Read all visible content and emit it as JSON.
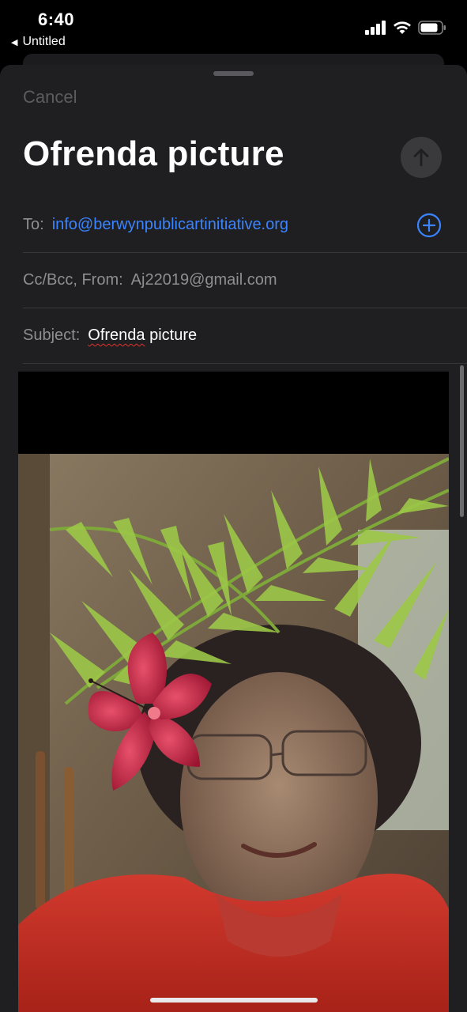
{
  "status_bar": {
    "time": "6:40",
    "back_app_label": "Untitled",
    "icons": [
      "cellular-signal-icon",
      "wifi-icon",
      "battery-icon"
    ]
  },
  "compose": {
    "cancel_label": "Cancel",
    "title": "Ofrenda picture",
    "send_icon": "arrow-up-icon",
    "to_label": "To:",
    "to_value": "info@berwynpublicartinitiative.org",
    "add_icon": "plus-circle-icon",
    "cc_label": "Cc/Bcc, From:",
    "from_value": "Aj22019@gmail.com",
    "subject_label": "Subject:",
    "subject_word_misspelled": "Ofrenda",
    "subject_rest": " picture"
  },
  "colors": {
    "link_blue": "#3a84ff",
    "sheet_bg": "#1f1f21",
    "spellcheck_red": "#e0332b"
  }
}
